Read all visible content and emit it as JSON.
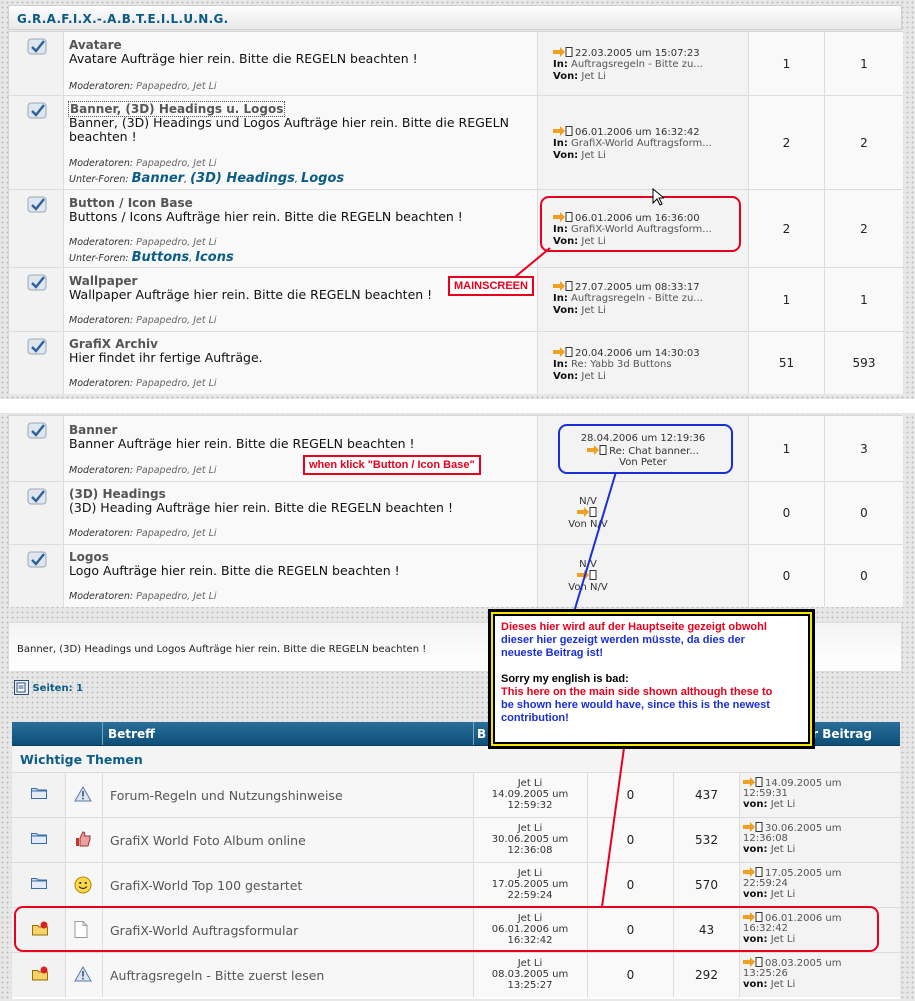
{
  "header": {
    "title": "G.R.A.F.I.X.-.A.B.T.E.I.L.U.N.G."
  },
  "forums": [
    {
      "title": "Avatare",
      "desc": "Avatare Aufträge hier rein. Bitte die REGELN beachten !",
      "mods_label": "Moderatoren:",
      "mods": "Papapedro, Jet Li",
      "last_date": "22.03.2005 um 15:07:23",
      "last_in_label": "In:",
      "last_in": "Auftragsregeln - Bitte zu...",
      "last_by_label": "Von:",
      "last_by": "Jet Li",
      "topics": "1",
      "posts": "1"
    },
    {
      "title": "Banner, (3D) Headings u. Logos",
      "desc": "Banner, (3D) Headings und Logos Aufträge hier rein. Bitte die REGELN beachten !",
      "mods_label": "Moderatoren:",
      "mods": "Papapedro, Jet Li",
      "sub_label": "Unter-Foren:",
      "subs": [
        "Banner",
        "(3D) Headings",
        "Logos"
      ],
      "last_date": "06.01.2006 um 16:32:42",
      "last_in_label": "In:",
      "last_in": "GrafiX-World Auftragsform...",
      "last_by_label": "Von:",
      "last_by": "Jet Li",
      "topics": "2",
      "posts": "2"
    },
    {
      "title": "Button / Icon Base",
      "desc": "Buttons / Icons Aufträge hier rein. Bitte die REGELN beachten !",
      "mods_label": "Moderatoren:",
      "mods": "Papapedro, Jet Li",
      "sub_label": "Unter-Foren:",
      "subs": [
        "Buttons",
        "Icons"
      ],
      "last_date": "06.01.2006 um 16:36:00",
      "last_in_label": "In:",
      "last_in": "GrafiX-World Auftragsform...",
      "last_by_label": "Von:",
      "last_by": "Jet Li",
      "topics": "2",
      "posts": "2"
    },
    {
      "title": "Wallpaper",
      "desc": "Wallpaper Aufträge hier rein. Bitte die REGELN beachten !",
      "mods_label": "Moderatoren:",
      "mods": "Papapedro, Jet Li",
      "last_date": "27.07.2005 um 08:33:17",
      "last_in_label": "In:",
      "last_in": "Auftragsregeln - Bitte zu...",
      "last_by_label": "Von:",
      "last_by": "Jet Li",
      "topics": "1",
      "posts": "1"
    },
    {
      "title": "GrafiX Archiv",
      "desc": "Hier findet ihr fertige Aufträge.",
      "mods_label": "Moderatoren:",
      "mods": "Papapedro, Jet Li",
      "last_date": "20.04.2006 um 14:30:03",
      "last_in_label": "In:",
      "last_in": "Re: Yabb 3d Buttons",
      "last_by_label": "Von:",
      "last_by": "Jet Li",
      "topics": "51",
      "posts": "593"
    }
  ],
  "annotations": {
    "mainscreen": "MAINSCREEN",
    "when_click": "when klick \"Button / Icon Base\""
  },
  "subforums": [
    {
      "title": "Banner",
      "desc": "Banner Aufträge hier rein. Bitte die REGELN beachten !",
      "mods_label": "Moderatoren:",
      "mods": "Papapedro, Jet Li",
      "last_date": "28.04.2006 um 12:19:36",
      "last_in": "Re: Chat banner...",
      "last_by": "Von Peter",
      "topics": "1",
      "posts": "3"
    },
    {
      "title": "(3D) Headings",
      "desc": "(3D) Heading Aufträge hier rein. Bitte die REGELN beachten !",
      "mods_label": "Moderatoren:",
      "mods": "Papapedro, Jet Li",
      "last_date": "N/V",
      "last_by": "Von N/V",
      "topics": "0",
      "posts": "0"
    },
    {
      "title": "Logos",
      "desc": "Logo Aufträge hier rein. Bitte die REGELN beachten !",
      "mods_label": "Moderatoren:",
      "mods": "Papapedro, Jet Li",
      "last_date": "N/V",
      "last_by": "Von N/V",
      "topics": "0",
      "posts": "0"
    }
  ],
  "forum_desc_bar": "Banner, (3D) Headings und Logos Aufträge hier rein. Bitte die REGELN beachten !",
  "pages": {
    "label": "Seiten:",
    "current": "1"
  },
  "note": {
    "line1": "Dieses hier wird auf der Hauptseite gezeigt obwohl",
    "line2": "dieser hier gezeigt werden müsste, da dies der",
    "line3": "neueste Beitrag ist!",
    "line4": "Sorry my english is bad:",
    "line5": "This here on the main side shown although these to",
    "line6": "be shown here would have, since this is the newest",
    "line7": "contribution!"
  },
  "topics_table": {
    "col_betreff": "Betreff",
    "col_b": "B",
    "col_last": "er Beitrag",
    "section": "Wichtige Themen",
    "rows": [
      {
        "icon": "folder-icon",
        "type_icon": "warning-icon",
        "title": "Forum-Regeln und Nutzungshinweise",
        "author": "Jet Li",
        "started": "14.09.2005 um",
        "started_time": "12:59:32",
        "replies": "0",
        "views": "437",
        "last_date": "14.09.2005 um",
        "last_time": "12:59:31",
        "last_by_label": "von:",
        "last_by": "Jet Li"
      },
      {
        "icon": "folder-icon",
        "type_icon": "thumbs-up-icon",
        "title": "GrafiX World Foto Album online",
        "author": "Jet Li",
        "started": "30.06.2005 um",
        "started_time": "12:36:08",
        "replies": "0",
        "views": "532",
        "last_date": "30.06.2005 um",
        "last_time": "12:36:08",
        "last_by_label": "von:",
        "last_by": "Jet Li"
      },
      {
        "icon": "folder-icon",
        "type_icon": "smiley-icon",
        "title": "GrafiX-World Top 100 gestartet",
        "author": "Jet Li",
        "started": "17.05.2005 um",
        "started_time": "22:59:24",
        "replies": "0",
        "views": "570",
        "last_date": "17.05.2005 um",
        "last_time": "22:59:24",
        "last_by_label": "von:",
        "last_by": "Jet Li"
      },
      {
        "icon": "hot-folder-icon",
        "type_icon": "document-icon",
        "title": "GrafiX-World Auftragsformular",
        "author": "Jet Li",
        "started": "06.01.2006 um",
        "started_time": "16:32:42",
        "replies": "0",
        "views": "43",
        "last_date": "06.01.2006 um",
        "last_time": "16:32:42",
        "last_by_label": "von:",
        "last_by": "Jet Li"
      },
      {
        "icon": "hot-folder-icon",
        "type_icon": "warning-icon",
        "title": "Auftragsregeln - Bitte zuerst lesen",
        "author": "Jet Li",
        "started": "08.03.2005 um",
        "started_time": "13:25:27",
        "replies": "0",
        "views": "292",
        "last_date": "08.03.2005 um",
        "last_time": "13:25:26",
        "last_by_label": "von:",
        "last_by": "Jet Li"
      }
    ]
  },
  "colors": {
    "accent": "#0b5c86",
    "annotation_red": "#e8001c",
    "annotation_blue": "#1a2fd6",
    "note_border": "#f5e600"
  }
}
